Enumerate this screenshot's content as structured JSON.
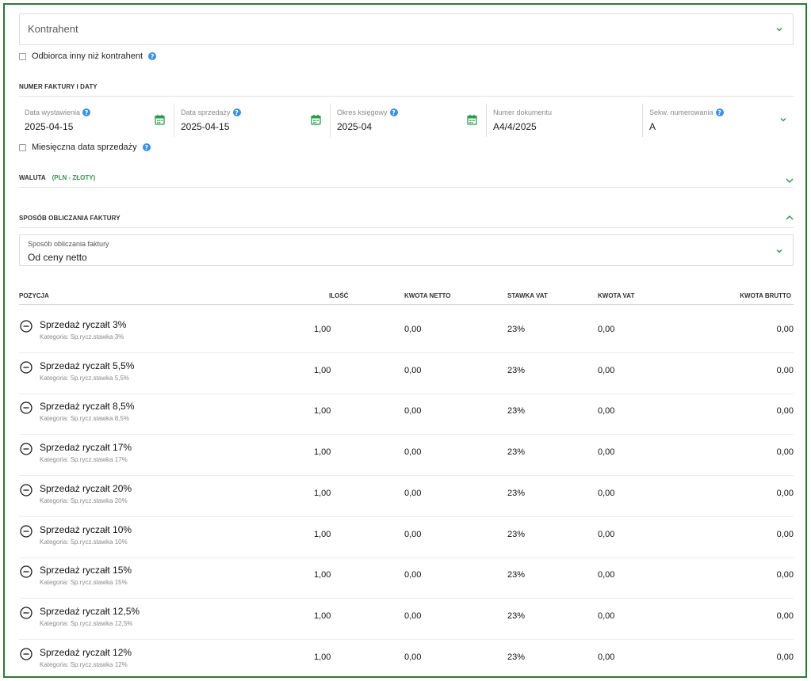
{
  "contractor": {
    "label": "Kontrahent"
  },
  "other_recipient": {
    "label": "Odbiorca inny niż kontrahent"
  },
  "invoice_section": {
    "title": "NUMER FAKTURY I DATY"
  },
  "fields": {
    "issue_date": {
      "label": "Data wystawienia",
      "value": "2025-04-15"
    },
    "sale_date": {
      "label": "Data sprzedaży",
      "value": "2025-04-15"
    },
    "period": {
      "label": "Okres księgowy",
      "value": "2025-04"
    },
    "doc_number": {
      "label": "Numer dokumentu",
      "value": "A4/4/2025"
    },
    "sequence": {
      "label": "Sekw. numerowania",
      "value": "A"
    }
  },
  "monthly_sale_date": {
    "label": "Miesięczna data sprzedaży"
  },
  "currency": {
    "title": "WALUTA",
    "value": "(PLN - ZŁOTY)"
  },
  "calc_section": {
    "title": "SPOSÓB OBLICZANIA FAKTURY"
  },
  "calc_field": {
    "label": "Sposób obliczania faktury",
    "value": "Od ceny netto"
  },
  "table": {
    "headers": {
      "position": "POZYCJA",
      "qty": "ILOŚĆ",
      "net": "KWOTA NETTO",
      "vat_rate": "STAWKA VAT",
      "vat_amount": "KWOTA VAT",
      "gross": "KWOTA BRUTTO"
    },
    "rows": [
      {
        "name": "Sprzedaż ryczałt 3%",
        "category": "Kategoria: Sp.rycz.stawka 3%",
        "qty": "1,00",
        "net": "0,00",
        "vat_rate": "23%",
        "vat_amount": "0,00",
        "gross": "0,00"
      },
      {
        "name": "Sprzedaż ryczałt 5,5%",
        "category": "Kategoria: Sp.rycz.stawka 5,5%",
        "qty": "1,00",
        "net": "0,00",
        "vat_rate": "23%",
        "vat_amount": "0,00",
        "gross": "0,00"
      },
      {
        "name": "Sprzedaż ryczałt 8,5%",
        "category": "Kategoria: Sp.rycz.stawka 8,5%",
        "qty": "1,00",
        "net": "0,00",
        "vat_rate": "23%",
        "vat_amount": "0,00",
        "gross": "0,00"
      },
      {
        "name": "Sprzedaż ryczałt 17%",
        "category": "Kategoria: Sp.rycz.stawka 17%",
        "qty": "1,00",
        "net": "0,00",
        "vat_rate": "23%",
        "vat_amount": "0,00",
        "gross": "0,00"
      },
      {
        "name": "Sprzedaż ryczałt 20%",
        "category": "Kategoria: Sp.rycz.stawka 20%",
        "qty": "1,00",
        "net": "0,00",
        "vat_rate": "23%",
        "vat_amount": "0,00",
        "gross": "0,00"
      },
      {
        "name": "Sprzedaż ryczałt 10%",
        "category": "Kategoria: Sp.rycz.stawka 10%",
        "qty": "1,00",
        "net": "0,00",
        "vat_rate": "23%",
        "vat_amount": "0,00",
        "gross": "0,00"
      },
      {
        "name": "Sprzedaż ryczałt 15%",
        "category": "Kategoria: Sp.rycz.stawka 15%",
        "qty": "1,00",
        "net": "0,00",
        "vat_rate": "23%",
        "vat_amount": "0,00",
        "gross": "0,00"
      },
      {
        "name": "Sprzedaż ryczałt 12,5%",
        "category": "Kategoria: Sp.rycz.stawka 12,5%",
        "qty": "1,00",
        "net": "0,00",
        "vat_rate": "23%",
        "vat_amount": "0,00",
        "gross": "0,00"
      },
      {
        "name": "Sprzedaż ryczałt 12%",
        "category": "Kategoria: Sp.rycz.stawka 12%",
        "qty": "1,00",
        "net": "0,00",
        "vat_rate": "23%",
        "vat_amount": "0,00",
        "gross": "0,00"
      }
    ]
  },
  "colors": {
    "accent": "#2d9a4b",
    "frame": "#2d7a3a",
    "help": "#3a8ee6"
  },
  "icons": {
    "dropdown": "chevron-down-icon",
    "collapse": "chevron-up-icon",
    "calendar": "calendar-icon",
    "remove": "minus-circle-icon",
    "help": "help-icon"
  }
}
